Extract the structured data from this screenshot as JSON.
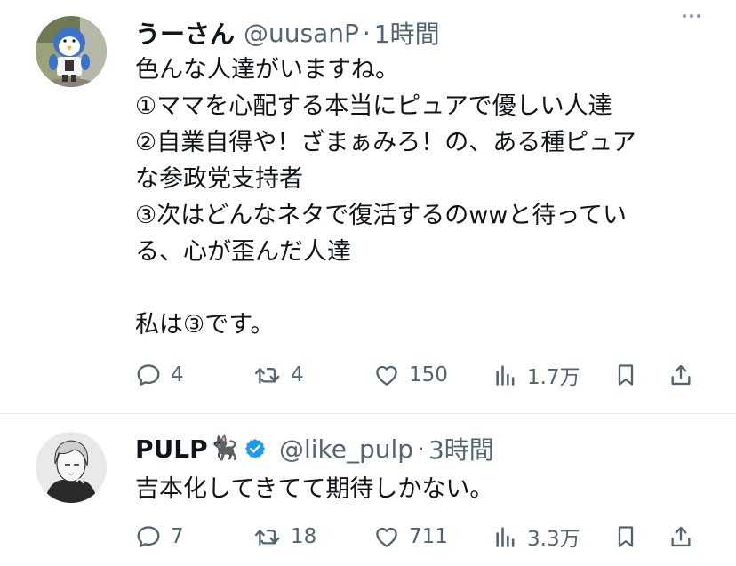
{
  "tweets": [
    {
      "name": "うーさん",
      "handle": "@uusanP",
      "separator": "·",
      "time": "1時間",
      "text_lines": [
        "色んな人達がいますね。",
        "①ママを心配する本当にピュアで優しい人達",
        "②自業自得や！ざまぁみろ！の、ある種ピュア",
        "な参政党支持者",
        "③次はどんなネタで復活するのwwと待ってい",
        "る、心が歪んだ人達",
        "",
        "私は③です。"
      ],
      "replies": "4",
      "retweets": "4",
      "likes": "150",
      "views": "1.7万",
      "avatar_icon": "penguin-mascot-avatar"
    },
    {
      "name": "PULP",
      "name_emoji": "🐈‍⬛",
      "verified": true,
      "handle": "@like_pulp",
      "separator": "·",
      "time": "3時間",
      "text_lines": [
        "吉本化してきてて期待しかない。"
      ],
      "replies": "7",
      "retweets": "18",
      "likes": "711",
      "views": "3.3万",
      "avatar_icon": "anime-portrait-avatar"
    }
  ],
  "colors": {
    "text": "#0f1419",
    "secondary": "#536471",
    "verified": "#1d9bf0",
    "divider": "#e6e9eb"
  }
}
